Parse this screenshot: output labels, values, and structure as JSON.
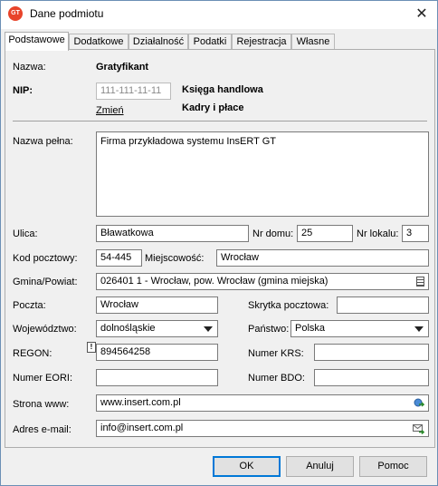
{
  "window": {
    "title": "Dane podmiotu",
    "close_glyph": "✕",
    "app_icon_text": "GT"
  },
  "tabs": [
    "Podstawowe",
    "Dodatkowe",
    "Działalność",
    "Podatki",
    "Rejestracja",
    "Własne"
  ],
  "form": {
    "nazwa_label": "Nazwa:",
    "nazwa_value": "Gratyfikant",
    "nip_label": "NIP:",
    "nip_placeholder": "111-111-11-11",
    "zmien_link": "Zmień",
    "ksiega": "Księga handlowa",
    "kadry": "Kadry i płace",
    "nazwa_pelna_label": "Nazwa pełna:",
    "nazwa_pelna_value": "Firma przykładowa systemu InsERT GT",
    "ulica_label": "Ulica:",
    "ulica_value": "Bławatkowa",
    "nr_domu_label": "Nr domu:",
    "nr_domu_value": "25",
    "nr_lokalu_label": "Nr lokalu:",
    "nr_lokalu_value": "3",
    "kod_label": "Kod pocztowy:",
    "kod_value": "54-445",
    "miejscowosc_label": "Miejscowość:",
    "miejscowosc_value": "Wrocław",
    "gmina_label": "Gmina/Powiat:",
    "gmina_value": "026401 1 - Wrocław, pow. Wrocław (gmina miejska)",
    "poczta_label": "Poczta:",
    "poczta_value": "Wrocław",
    "skrytka_label": "Skrytka pocztowa:",
    "skrytka_value": "",
    "wojewodztwo_label": "Województwo:",
    "wojewodztwo_value": "dolnośląskie",
    "panstwo_label": "Państwo:",
    "panstwo_value": "Polska",
    "regon_label": "REGON:",
    "regon_value": "894564258",
    "regon_warn": "!",
    "krs_label": "Numer KRS:",
    "krs_value": "",
    "eori_label": "Numer EORI:",
    "eori_value": "",
    "bdo_label": "Numer BDO:",
    "bdo_value": "",
    "www_label": "Strona www:",
    "www_value": "www.insert.com.pl",
    "email_label": "Adres e-mail:",
    "email_value": "info@insert.com.pl"
  },
  "buttons": {
    "ok": "OK",
    "cancel": "Anuluj",
    "help": "Pomoc"
  }
}
